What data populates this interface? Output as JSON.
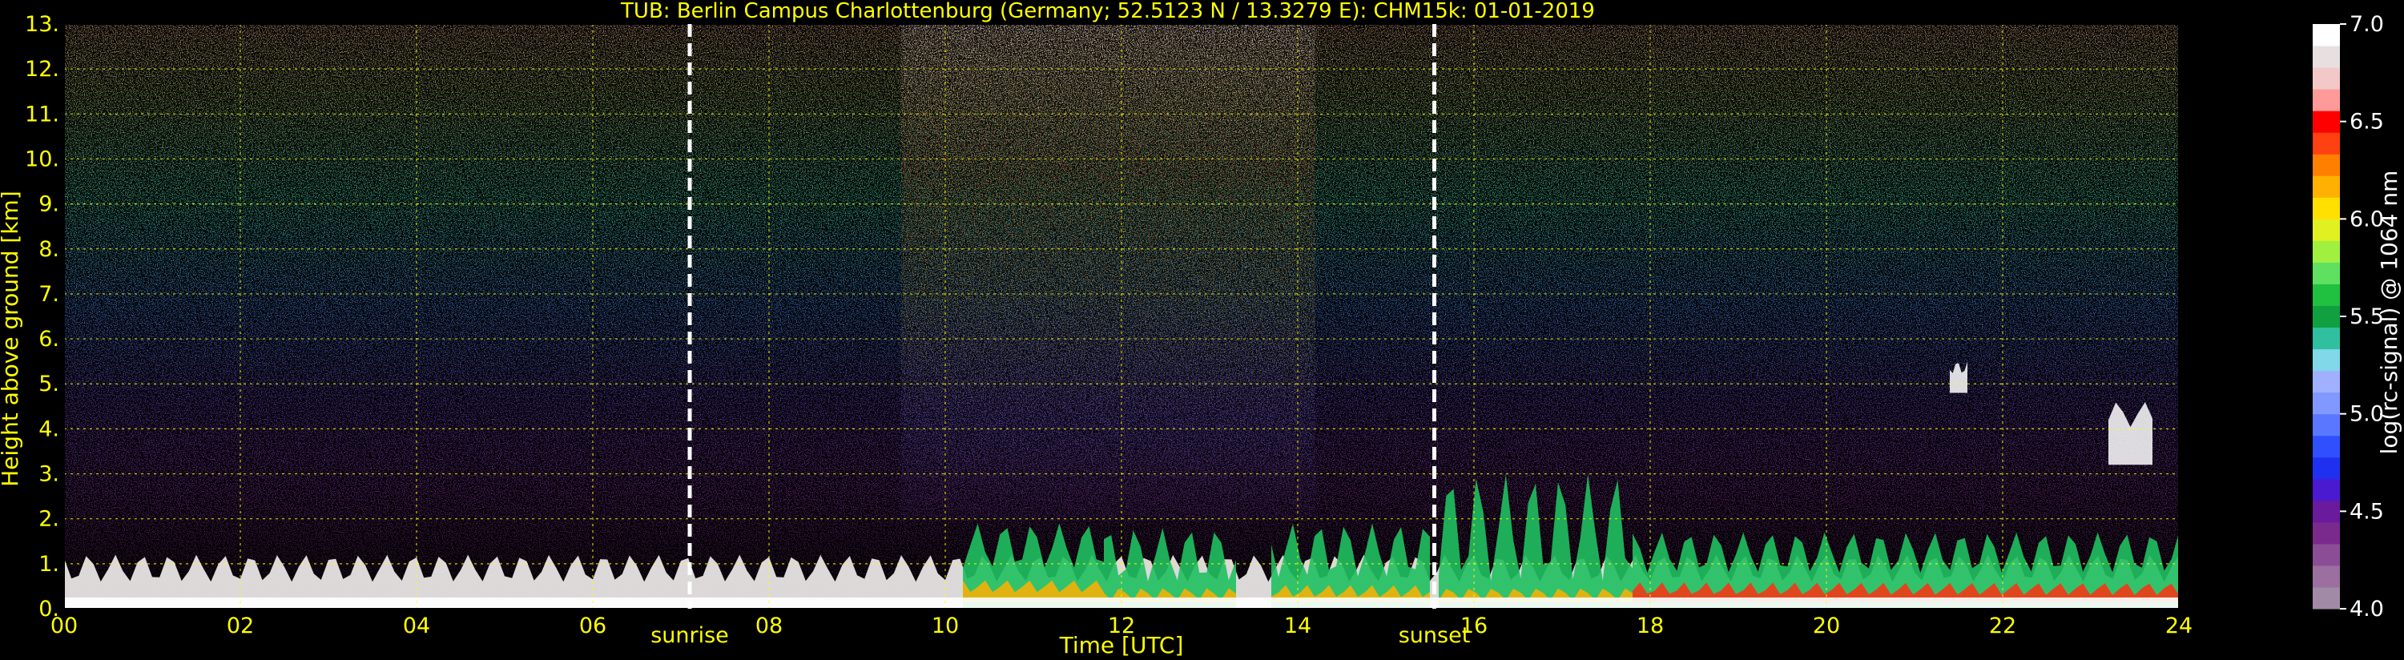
{
  "chart_data": {
    "type": "heatmap",
    "title": "TUB: Berlin Campus Charlottenburg (Germany; 52.5123 N / 13.3279 E):    CHM15k: 01-01-2019",
    "xlabel": "Time [UTC]",
    "ylabel": "Height above ground [km]",
    "xlim": [
      0,
      24
    ],
    "ylim": [
      0,
      13
    ],
    "x_ticks": [
      "00",
      "02",
      "04",
      "06",
      "08",
      "10",
      "12",
      "14",
      "16",
      "18",
      "20",
      "22",
      "24"
    ],
    "y_ticks": [
      "0.",
      "1.",
      "2.",
      "3.",
      "4.",
      "5.",
      "6.",
      "7.",
      "8.",
      "9.",
      "10.",
      "11.",
      "12.",
      "13."
    ],
    "grid": true,
    "events": [
      {
        "label": "sunrise",
        "time": 7.1
      },
      {
        "label": "sunset",
        "time": 15.55
      }
    ],
    "colorbar": {
      "label": "log(rc-signal) @ 1064 nm",
      "range": [
        4.0,
        7.0
      ],
      "ticks": [
        "4.0",
        "4.5",
        "5.0",
        "5.5",
        "6.0",
        "6.5",
        "7.0"
      ],
      "tick_values": [
        4.0,
        4.5,
        5.0,
        5.5,
        6.0,
        6.5,
        7.0
      ],
      "colors": [
        "#a08aa6",
        "#9b6fa0",
        "#8a4d96",
        "#7a2a8c",
        "#6a1a9c",
        "#4a1ad0",
        "#2030f0",
        "#3050ff",
        "#5a78ff",
        "#8098ff",
        "#a0b0ff",
        "#80d8e8",
        "#30c0a0",
        "#10a040",
        "#20c040",
        "#60e060",
        "#a0f040",
        "#e0f020",
        "#ffe000",
        "#ffb000",
        "#ff8000",
        "#ff4010",
        "#ff0000",
        "#ff9a9a",
        "#f2c8c8",
        "#e8e0e0",
        "#ffffff"
      ]
    },
    "layers": [
      {
        "kind": "noise_background",
        "height_km": [
          0,
          13
        ]
      },
      {
        "kind": "boundary_layer",
        "time": [
          0,
          24
        ],
        "top_km": [
          0.6,
          1.2
        ]
      },
      {
        "kind": "cloud",
        "time": [
          10.2,
          11.8
        ],
        "top_km": [
          0.9,
          1.9
        ]
      },
      {
        "kind": "cloud",
        "time": [
          11.8,
          13.3
        ],
        "top_km": [
          0.6,
          1.8
        ]
      },
      {
        "kind": "cloud",
        "time": [
          13.7,
          15.5
        ],
        "top_km": [
          0.7,
          1.9
        ]
      },
      {
        "kind": "cloud",
        "time": [
          15.6,
          17.8
        ],
        "top_km": [
          0.6,
          3.0
        ]
      },
      {
        "kind": "cloud",
        "time": [
          17.8,
          24.0
        ],
        "top_km": [
          0.8,
          1.7
        ]
      },
      {
        "kind": "cloud",
        "time": [
          21.4,
          21.6
        ],
        "top_km": [
          4.8,
          5.5
        ]
      },
      {
        "kind": "cloud",
        "time": [
          23.2,
          23.7
        ],
        "top_km": [
          3.2,
          4.6
        ]
      }
    ],
    "colors": {
      "text": "#ffff00",
      "grid": "#ffff00",
      "colorbar_text": "#ffffff",
      "event_line": "#ffffff",
      "background": "#000000"
    }
  }
}
